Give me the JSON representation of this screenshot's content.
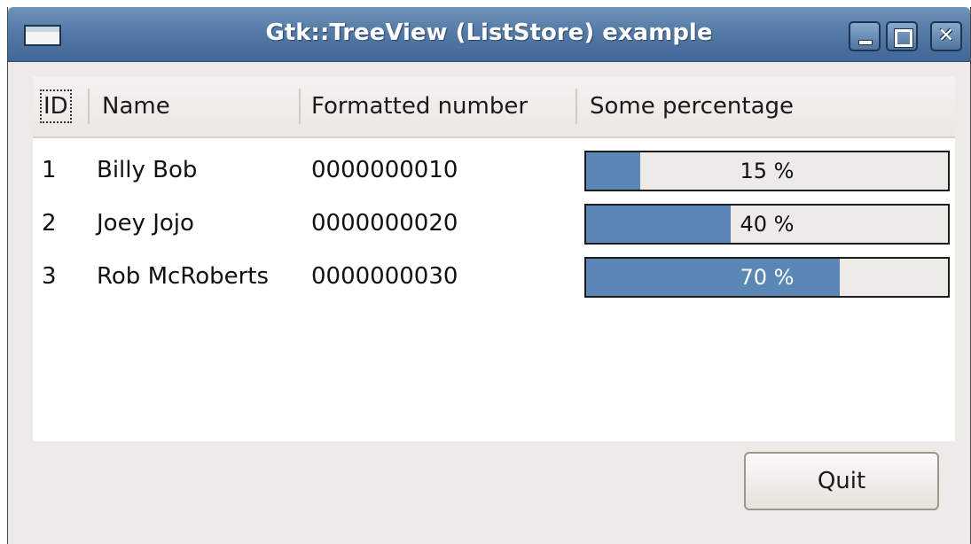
{
  "window": {
    "title": "Gtk::TreeView (ListStore) example",
    "icons": {
      "menu": "window-menu-icon",
      "minimize": "minimize-icon",
      "maximize": "maximize-icon",
      "close": "close-icon"
    },
    "close_glyph": "✕",
    "colors": {
      "titlebar": "#557aa5",
      "progress_fill": "#5a87b5",
      "window_bg": "#edebe7"
    }
  },
  "treeview": {
    "columns": [
      "ID",
      "Name",
      "Formatted number",
      "Some percentage"
    ],
    "rows": [
      {
        "id": "1",
        "name": "Billy Bob",
        "number": "0000000010",
        "percent": 15,
        "percent_label": "15 %"
      },
      {
        "id": "2",
        "name": "Joey Jojo",
        "number": "0000000020",
        "percent": 40,
        "percent_label": "40 %"
      },
      {
        "id": "3",
        "name": "Rob McRoberts",
        "number": "0000000030",
        "percent": 70,
        "percent_label": "70 %"
      }
    ]
  },
  "buttons": {
    "quit_label": "Quit"
  }
}
